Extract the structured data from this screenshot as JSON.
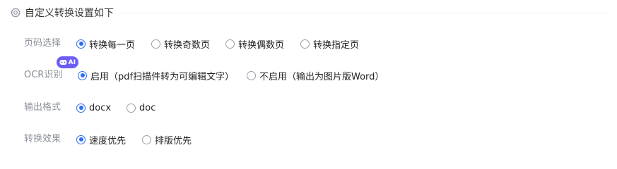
{
  "section": {
    "icon": "gear-icon",
    "title": "自定义转换设置如下"
  },
  "page_range": {
    "label": "页码选择",
    "options": [
      "转换每一页",
      "转换奇数页",
      "转换偶数页",
      "转换指定页"
    ],
    "selected": "转换每一页"
  },
  "ocr": {
    "label": "OCR识别",
    "badge_text": "AI",
    "badge_color": "#6b5cf6",
    "options": [
      "启用（pdf扫描件转为可编辑文字）",
      "不启用（输出为图片版Word）"
    ],
    "selected": "启用（pdf扫描件转为可编辑文字）"
  },
  "output_format": {
    "label": "输出格式",
    "options": [
      "docx",
      "doc"
    ],
    "selected": "docx"
  },
  "conversion_mode": {
    "label": "转换效果",
    "options": [
      "速度优先",
      "排版优先"
    ],
    "selected": "速度优先"
  },
  "colors": {
    "accent": "#2f6df3",
    "label_gray": "#8a8f99"
  }
}
